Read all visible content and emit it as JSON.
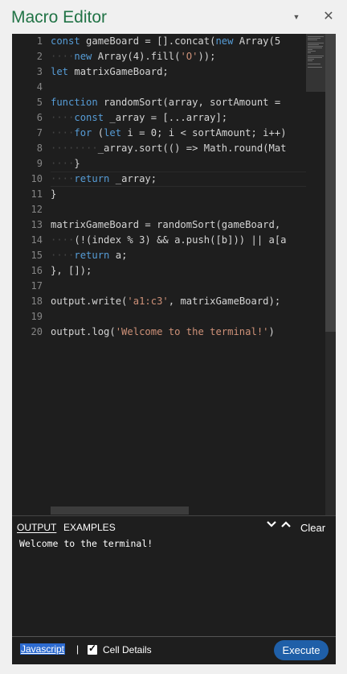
{
  "window": {
    "title": "Macro Editor",
    "dropdown_glyph": "▼",
    "close_glyph": "✕"
  },
  "editor": {
    "line_numbers": [
      "1",
      "2",
      "3",
      "4",
      "5",
      "6",
      "7",
      "8",
      "9",
      "10",
      "11",
      "12",
      "13",
      "14",
      "15",
      "16",
      "17",
      "18",
      "19",
      "20"
    ],
    "highlighted_line": 10
  },
  "output": {
    "tabs": [
      "OUTPUT",
      "EXAMPLES"
    ],
    "active_tab": "OUTPUT",
    "collapse_glyph": "⌄",
    "expand_glyph": "⌃",
    "clear_label": "Clear",
    "text": "Welcome to the terminal!"
  },
  "footer": {
    "language": "Javascript",
    "separator": "|",
    "cell_details_label": "Cell Details",
    "cell_details_checked": true,
    "check_glyph": "✓",
    "execute_label": "Execute"
  },
  "colors": {
    "accent_green": "#217346",
    "execute_blue": "#1f5fa8",
    "keyword": "#569cd6",
    "string": "#ce9178"
  }
}
